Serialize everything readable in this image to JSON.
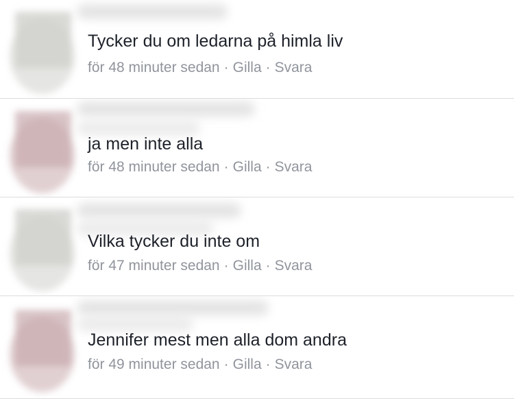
{
  "comments": [
    {
      "text": "Tycker du om ledarna på himla liv",
      "time": "för 48 minuter sedan",
      "like_label": "Gilla",
      "reply_label": "Svara",
      "avatar_color": "#d9dad6"
    },
    {
      "text": "ja men inte alla",
      "time": "för 48 minuter sedan",
      "like_label": "Gilla",
      "reply_label": "Svara",
      "avatar_color": "#d8c3c6"
    },
    {
      "text": "Vilka tycker du inte om",
      "time": "för 47 minuter sedan",
      "like_label": "Gilla",
      "reply_label": "Svara",
      "avatar_color": "#d9dad6"
    },
    {
      "text": "Jennifer mest men alla dom andra",
      "time": "för 49 minuter sedan",
      "like_label": "Gilla",
      "reply_label": "Svara",
      "avatar_color": "#d8c3c6"
    }
  ],
  "separator": "·",
  "colors": {
    "text": "#1d2129",
    "meta": "#90949c",
    "divider": "#dcdcdc"
  }
}
